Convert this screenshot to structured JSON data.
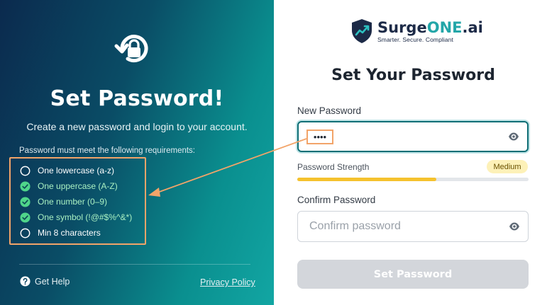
{
  "left": {
    "title": "Set Password!",
    "subtitle": "Create a new password and login to your account.",
    "requirements_heading": "Password must meet the following requirements:",
    "requirements": [
      {
        "label": "One lowercase (a-z)",
        "met": false
      },
      {
        "label": "One uppercase (A-Z)",
        "met": true
      },
      {
        "label": "One number (0–9)",
        "met": true
      },
      {
        "label": "One symbol (!@#$%^&*)",
        "met": true
      },
      {
        "label": "Min 8 characters",
        "met": false
      }
    ],
    "help_label": "Get Help",
    "privacy_label": "Privacy Policy"
  },
  "brand": {
    "name_part1": "Surge",
    "name_part2": "ONE",
    "name_part3": ".ai",
    "tagline": "Smarter. Secure. Compliant"
  },
  "form": {
    "title": "Set Your Password",
    "new_password_label": "New Password",
    "new_password_value": "Abc1",
    "new_password_masked": "••••",
    "strength_label": "Password Strength",
    "strength_value": "Medium",
    "strength_fraction": 0.6,
    "confirm_password_label": "Confirm Password",
    "confirm_password_placeholder": "Confirm password",
    "confirm_password_value": "",
    "submit_label": "Set Password"
  },
  "colors": {
    "accent_teal": "#23a6a8",
    "met_green": "#4fd68a",
    "strength_yellow": "#f5c22e",
    "annotation_orange": "#f2a469"
  },
  "icons": {
    "left_top": "lock-reset-icon",
    "eye": "eye-icon",
    "help": "question-circle-icon",
    "met": "check-circle-icon",
    "unmet": "empty-circle-icon",
    "brand": "shield-chart-icon"
  }
}
